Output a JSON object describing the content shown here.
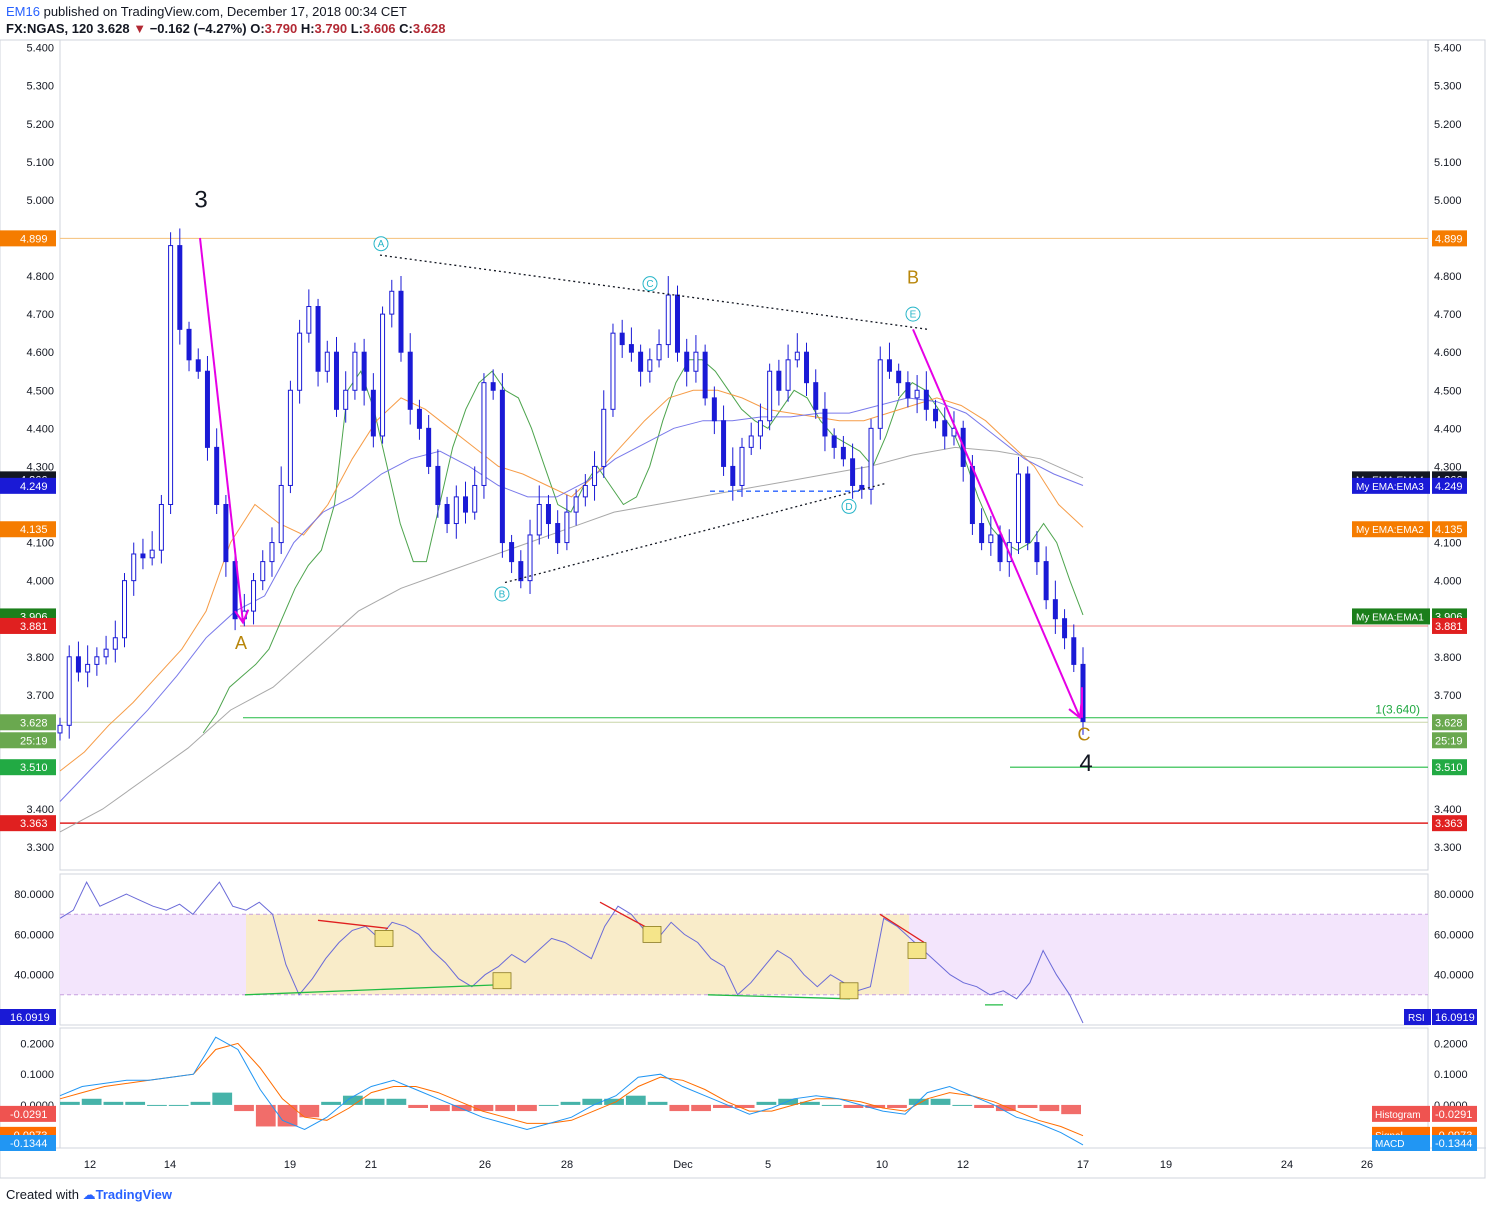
{
  "header": {
    "user": "EM16",
    "published": "published on TradingView.com, December 17, 2018 00:34 CET",
    "symbol": "FX:NGAS, 120",
    "last": "3.628",
    "change": "−0.162 (−4.27%)",
    "o_label": "O:",
    "o": "3.790",
    "h_label": "H:",
    "h": "3.790",
    "l_label": "L:",
    "l": "3.606",
    "c_label": "C:",
    "c": "3.628"
  },
  "footer": {
    "created": "Created with",
    "brand": "TradingView"
  },
  "colors": {
    "candle": "#1a1ad6",
    "ema1": "#3a9a3a",
    "ema2": "#f59133",
    "ema3": "#6a6ae8",
    "ema4": "#9e9e9e",
    "arrow": "#e600e6",
    "wave_label": "#b8860b",
    "marker": "#26b5c8",
    "rsi_line": "#6a6ad8",
    "rsi_band": "#f3e5fc",
    "rsi_range": "#f9ecc9",
    "macd": "#2196f3",
    "signal": "#ff6d00",
    "hist_up": "#26a69a",
    "hist_down": "#ef5350"
  },
  "chart_data": [
    {
      "type": "candlestick",
      "title": "",
      "ylim": [
        3.24,
        5.42
      ],
      "y_ticks": [
        "5.400",
        "5.300",
        "5.200",
        "5.100",
        "5.000",
        "4.800",
        "4.700",
        "4.600",
        "4.500",
        "4.400",
        "4.300",
        "4.100",
        "4.000",
        "3.800",
        "3.700",
        "3.400",
        "3.300"
      ],
      "x_ticks": [
        "12",
        "14",
        "19",
        "21",
        "26",
        "28",
        "Dec",
        "5",
        "10",
        "12",
        "17",
        "19",
        "24",
        "26"
      ],
      "series": [
        {
          "name": "Price",
          "values": [
            3.62,
            3.8,
            3.76,
            3.78,
            3.8,
            3.82,
            3.85,
            4.0,
            4.07,
            4.06,
            4.08,
            4.2,
            4.88,
            4.66,
            4.58,
            4.55,
            4.35,
            4.2,
            4.05,
            3.9,
            3.92,
            4.0,
            4.05,
            4.1,
            4.25,
            4.5,
            4.65,
            4.72,
            4.55,
            4.6,
            4.45,
            4.5,
            4.6,
            4.5,
            4.38,
            4.7,
            4.76,
            4.6,
            4.45,
            4.4,
            4.3,
            4.2,
            4.15,
            4.22,
            4.18,
            4.25,
            4.52,
            4.5,
            4.1,
            4.05,
            4.0,
            4.12,
            4.2,
            4.15,
            4.1,
            4.18,
            4.22,
            4.25,
            4.3,
            4.45,
            4.65,
            4.62,
            4.6,
            4.55,
            4.58,
            4.62,
            4.75,
            4.6,
            4.55,
            4.6,
            4.48,
            4.42,
            4.3,
            4.25,
            4.35,
            4.38,
            4.42,
            4.55,
            4.5,
            4.58,
            4.6,
            4.52,
            4.45,
            4.38,
            4.35,
            4.32,
            4.25,
            4.24,
            4.4,
            4.58,
            4.55,
            4.52,
            4.48,
            4.5,
            4.45,
            4.42,
            4.38,
            4.4,
            4.3,
            4.15,
            4.1,
            4.12,
            4.05,
            4.1,
            4.28,
            4.1,
            4.05,
            3.95,
            3.9,
            3.85,
            3.78,
            3.63
          ]
        },
        {
          "name": "My EMA:EMA1",
          "values": [
            3.6,
            3.65,
            3.72,
            3.75,
            3.78,
            3.82,
            3.9,
            3.98,
            4.04,
            4.08,
            4.2,
            4.5,
            4.55,
            4.45,
            4.3,
            4.15,
            4.05,
            4.05,
            4.2,
            4.35,
            4.45,
            4.52,
            4.55,
            4.5,
            4.48,
            4.4,
            4.3,
            4.2,
            4.18,
            4.25,
            4.3,
            4.25,
            4.2,
            4.22,
            4.3,
            4.42,
            4.52,
            4.58,
            4.58,
            4.55,
            4.5,
            4.45,
            4.42,
            4.4,
            4.45,
            4.5,
            4.48,
            4.42,
            4.38,
            4.36,
            4.34,
            4.3,
            4.38,
            4.48,
            4.52,
            4.5,
            4.45,
            4.4,
            4.32,
            4.22,
            4.14,
            4.1,
            4.08,
            4.1,
            4.15,
            4.1,
            4.0,
            3.91
          ]
        },
        {
          "name": "My EMA:EMA2",
          "values": [
            3.5,
            3.55,
            3.62,
            3.68,
            3.75,
            3.82,
            3.92,
            4.1,
            4.2,
            4.15,
            4.12,
            4.2,
            4.32,
            4.42,
            4.48,
            4.45,
            4.4,
            4.35,
            4.3,
            4.28,
            4.25,
            4.22,
            4.28,
            4.35,
            4.42,
            4.48,
            4.5,
            4.5,
            4.48,
            4.45,
            4.44,
            4.43,
            4.42,
            4.42,
            4.44,
            4.46,
            4.48,
            4.46,
            4.42,
            4.36,
            4.3,
            4.2,
            4.14
          ]
        },
        {
          "name": "My EMA:EMA3",
          "values": [
            3.42,
            3.5,
            3.58,
            3.66,
            3.75,
            3.85,
            3.92,
            3.96,
            4.1,
            4.18,
            4.22,
            4.28,
            4.32,
            4.34,
            4.3,
            4.25,
            4.22,
            4.22,
            4.26,
            4.32,
            4.36,
            4.4,
            4.42,
            4.42,
            4.43,
            4.43,
            4.44,
            4.44,
            4.46,
            4.48,
            4.47,
            4.44,
            4.38,
            4.32,
            4.28,
            4.25
          ]
        },
        {
          "name": "My EMA:EMA4",
          "values": [
            3.34,
            3.4,
            3.48,
            3.56,
            3.66,
            3.72,
            3.82,
            3.92,
            3.98,
            4.02,
            4.06,
            4.1,
            4.14,
            4.18,
            4.2,
            4.22,
            4.24,
            4.26,
            4.28,
            4.3,
            4.33,
            4.35,
            4.34,
            4.32,
            4.27
          ]
        }
      ],
      "price_labels": [
        {
          "value": "4.899",
          "color": "#f57c00"
        },
        {
          "value": "4.266",
          "color": "#131722"
        },
        {
          "value": "4.249",
          "color": "#1a1ad6"
        },
        {
          "value": "4.135",
          "color": "#f57c00"
        },
        {
          "value": "3.906",
          "color": "#1b7f1b"
        },
        {
          "value": "3.881",
          "color": "#e02020"
        },
        {
          "value": "3.628",
          "color": "#6aa84f"
        },
        {
          "value": "25:19",
          "color": "#6aa84f"
        },
        {
          "value": "3.510",
          "color": "#22aa44"
        },
        {
          "value": "3.363",
          "color": "#e02020"
        }
      ],
      "ema_labels": [
        {
          "name": "My EMA:EMA4",
          "value": "4.266",
          "color": "#131722"
        },
        {
          "name": "My EMA:EMA3",
          "value": "4.249",
          "color": "#1a1ad6"
        },
        {
          "name": "My EMA:EMA2",
          "value": "4.135",
          "color": "#f57c00"
        },
        {
          "name": "My EMA:EMA1",
          "value": "3.906",
          "color": "#1b7f1b"
        }
      ],
      "annotations": {
        "wave3": "3",
        "waveA": "A",
        "waveB": "B",
        "waveC": "C",
        "wave4": "4",
        "circles": [
          "A",
          "B",
          "C",
          "D",
          "E"
        ],
        "fib": "1(3.640)"
      }
    },
    {
      "type": "line",
      "name": "RSI",
      "ylim": [
        15,
        90
      ],
      "y_ticks": [
        "80.0000",
        "60.0000",
        "40.0000"
      ],
      "band": [
        30,
        70
      ],
      "last_label": "16.0919",
      "legend": "RSI",
      "values": [
        68,
        72,
        86,
        74,
        77,
        80,
        77,
        74,
        72,
        75,
        70,
        78,
        86,
        74,
        72,
        76,
        70,
        45,
        30,
        38,
        48,
        56,
        62,
        64,
        58,
        66,
        64,
        60,
        52,
        46,
        38,
        34,
        40,
        44,
        50,
        46,
        52,
        58,
        56,
        52,
        48,
        64,
        74,
        70,
        62,
        58,
        66,
        60,
        56,
        48,
        44,
        30,
        36,
        44,
        52,
        48,
        40,
        34,
        40,
        36,
        32,
        34,
        68,
        64,
        58,
        52,
        46,
        40,
        36,
        34,
        30,
        32,
        28,
        36,
        52,
        40,
        30,
        16
      ]
    },
    {
      "type": "line",
      "name": "MACD",
      "ylim": [
        -0.14,
        0.25
      ],
      "y_ticks": [
        "0.2000",
        "0.1000",
        "0.0000"
      ],
      "legend": [
        "Histogram",
        "Signal",
        "MACD"
      ],
      "last_labels": {
        "histogram": "-0.0291",
        "signal": "-0.0973",
        "macd": "-0.1344"
      },
      "macd": [
        0.03,
        0.06,
        0.07,
        0.08,
        0.08,
        0.09,
        0.1,
        0.22,
        0.18,
        0.05,
        -0.05,
        -0.08,
        -0.04,
        0.02,
        0.06,
        0.08,
        0.05,
        0.02,
        -0.01,
        -0.04,
        -0.06,
        -0.08,
        -0.06,
        -0.04,
        0.0,
        0.03,
        0.09,
        0.1,
        0.06,
        0.03,
        0.0,
        -0.03,
        -0.01,
        0.02,
        0.03,
        0.02,
        0.0,
        -0.02,
        -0.03,
        0.04,
        0.06,
        0.03,
        0.0,
        -0.04,
        -0.06,
        -0.09,
        -0.13
      ],
      "signal": [
        0.02,
        0.04,
        0.06,
        0.07,
        0.08,
        0.09,
        0.1,
        0.18,
        0.2,
        0.12,
        0.02,
        -0.04,
        -0.05,
        -0.01,
        0.04,
        0.06,
        0.06,
        0.04,
        0.01,
        -0.02,
        -0.04,
        -0.06,
        -0.06,
        -0.05,
        -0.02,
        0.01,
        0.06,
        0.09,
        0.08,
        0.05,
        0.01,
        -0.02,
        -0.02,
        0.0,
        0.02,
        0.02,
        0.01,
        -0.01,
        -0.02,
        0.02,
        0.04,
        0.03,
        0.01,
        -0.02,
        -0.05,
        -0.07,
        -0.1
      ],
      "histogram": [
        0.01,
        0.02,
        0.01,
        0.01,
        0.0,
        0.0,
        0.01,
        0.04,
        -0.02,
        -0.07,
        -0.07,
        -0.04,
        0.01,
        0.03,
        0.02,
        0.02,
        -0.01,
        -0.02,
        -0.02,
        -0.02,
        -0.02,
        -0.02,
        0.0,
        0.01,
        0.02,
        0.02,
        0.03,
        0.01,
        -0.02,
        -0.02,
        -0.01,
        -0.01,
        0.01,
        0.02,
        0.01,
        0.0,
        -0.01,
        -0.01,
        -0.01,
        0.02,
        0.02,
        0.0,
        -0.01,
        -0.02,
        -0.01,
        -0.02,
        -0.03
      ]
    }
  ]
}
